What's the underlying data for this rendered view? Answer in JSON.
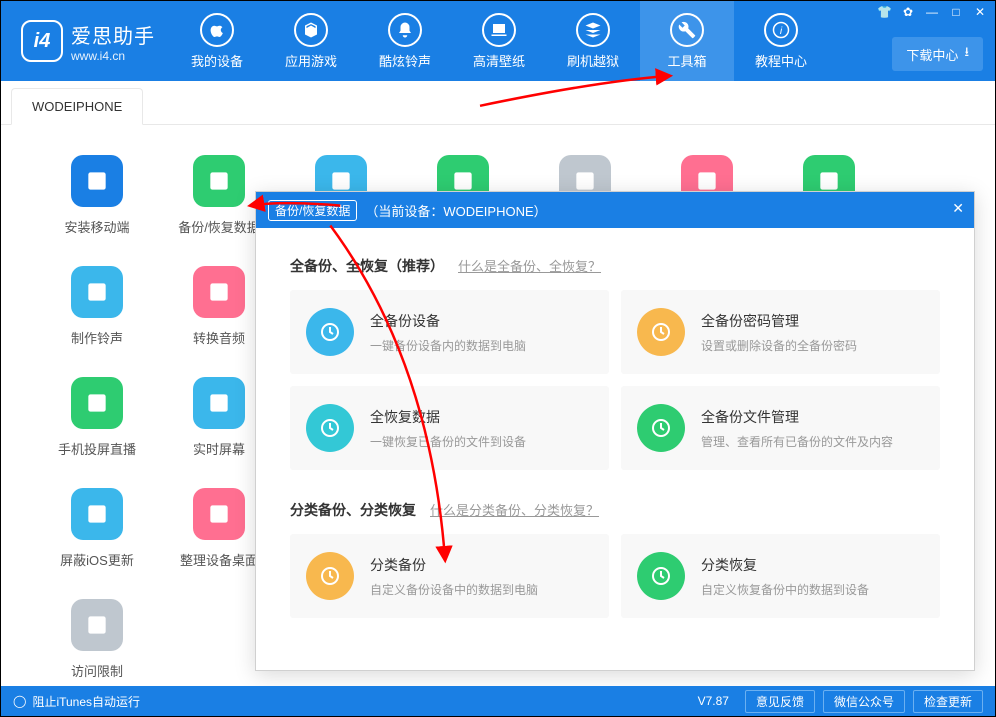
{
  "logo": {
    "badge": "i4",
    "name": "爱思助手",
    "domain": "www.i4.cn"
  },
  "nav": [
    {
      "label": "我的设备"
    },
    {
      "label": "应用游戏"
    },
    {
      "label": "酷炫铃声"
    },
    {
      "label": "高清壁纸"
    },
    {
      "label": "刷机越狱"
    },
    {
      "label": "工具箱"
    },
    {
      "label": "教程中心"
    }
  ],
  "downloadCenter": "下载中心",
  "deviceTab": "WODEIPHONE",
  "tools": [
    {
      "label": "安装移动端",
      "color": "#1a7fe4"
    },
    {
      "label": "备份/恢复数据",
      "color": "#2ecc71"
    },
    {
      "label": "",
      "color": "#3bb7eb"
    },
    {
      "label": "",
      "color": "#2ecc71"
    },
    {
      "label": "",
      "color": "#bfc7cf"
    },
    {
      "label": "",
      "color": "#ff6f91"
    },
    {
      "label": "",
      "color": "#2ecc71"
    },
    {
      "label": "制作铃声",
      "color": "#3bb7eb"
    },
    {
      "label": "转换音频",
      "color": "#ff6f91"
    },
    {
      "label": "",
      "color": "transparent"
    },
    {
      "label": "",
      "color": "transparent"
    },
    {
      "label": "",
      "color": "transparent"
    },
    {
      "label": "",
      "color": "transparent"
    },
    {
      "label": "",
      "color": "transparent"
    },
    {
      "label": "手机投屏直播",
      "color": "#2ecc71"
    },
    {
      "label": "实时屏幕",
      "color": "#3bb7eb"
    },
    {
      "label": "",
      "color": "transparent"
    },
    {
      "label": "",
      "color": "transparent"
    },
    {
      "label": "",
      "color": "transparent"
    },
    {
      "label": "",
      "color": "transparent"
    },
    {
      "label": "",
      "color": "transparent"
    },
    {
      "label": "屏蔽iOS更新",
      "color": "#3bb7eb"
    },
    {
      "label": "整理设备桌面",
      "color": "#ff6f91"
    },
    {
      "label": "",
      "color": "transparent"
    },
    {
      "label": "",
      "color": "transparent"
    },
    {
      "label": "",
      "color": "transparent"
    },
    {
      "label": "",
      "color": "transparent"
    },
    {
      "label": "",
      "color": "transparent"
    },
    {
      "label": "访问限制",
      "color": "#bfc7cf"
    }
  ],
  "modal": {
    "titleChip": "备份/恢复数据",
    "deviceText": "（当前设备：WODEIPHONE）",
    "section1": {
      "title": "全备份、全恢复（推荐）",
      "help": "什么是全备份、全恢复？"
    },
    "section2": {
      "title": "分类备份、分类恢复",
      "help": "什么是分类备份、分类恢复？"
    },
    "cards1": [
      {
        "title": "全备份设备",
        "desc": "一键备份设备内的数据到电脑",
        "color": "#3bb7eb"
      },
      {
        "title": "全备份密码管理",
        "desc": "设置或删除设备的全备份密码",
        "color": "#f8b84e"
      },
      {
        "title": "全恢复数据",
        "desc": "一键恢复已备份的文件到设备",
        "color": "#33c8d6"
      },
      {
        "title": "全备份文件管理",
        "desc": "管理、查看所有已备份的文件及内容",
        "color": "#2ecc71"
      }
    ],
    "cards2": [
      {
        "title": "分类备份",
        "desc": "自定义备份设备中的数据到电脑",
        "color": "#f8b84e"
      },
      {
        "title": "分类恢复",
        "desc": "自定义恢复备份中的数据到设备",
        "color": "#2ecc71"
      }
    ]
  },
  "footer": {
    "itunes": "阻止iTunes自动运行",
    "version": "V7.87",
    "buttons": [
      "意见反馈",
      "微信公众号",
      "检查更新"
    ]
  }
}
